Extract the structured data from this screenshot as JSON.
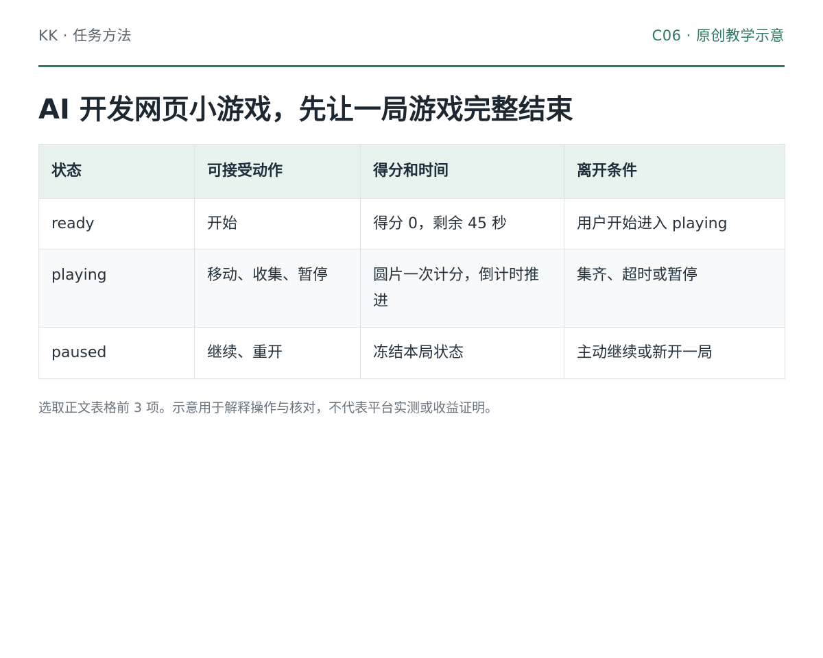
{
  "header": {
    "brand": "KK · 任务方法",
    "code": "C06 · 原创教学示意"
  },
  "title": "AI 开发网页小游戏，先让一局游戏完整结束",
  "table": {
    "columns": [
      "状态",
      "可接受动作",
      "得分和时间",
      "离开条件"
    ],
    "rows": [
      [
        "ready",
        "开始",
        "得分 0，剩余 45 秒",
        "用户开始进入 playing"
      ],
      [
        "playing",
        "移动、收集、暂停",
        "圆片一次计分，倒计时推进",
        "集齐、超时或暂停"
      ],
      [
        "paused",
        "继续、重开",
        "冻结本局状态",
        "主动继续或新开一局"
      ]
    ]
  },
  "footnote": "选取正文表格前 3 项。示意用于解释操作与核对，不代表平台实测或收益证明。"
}
